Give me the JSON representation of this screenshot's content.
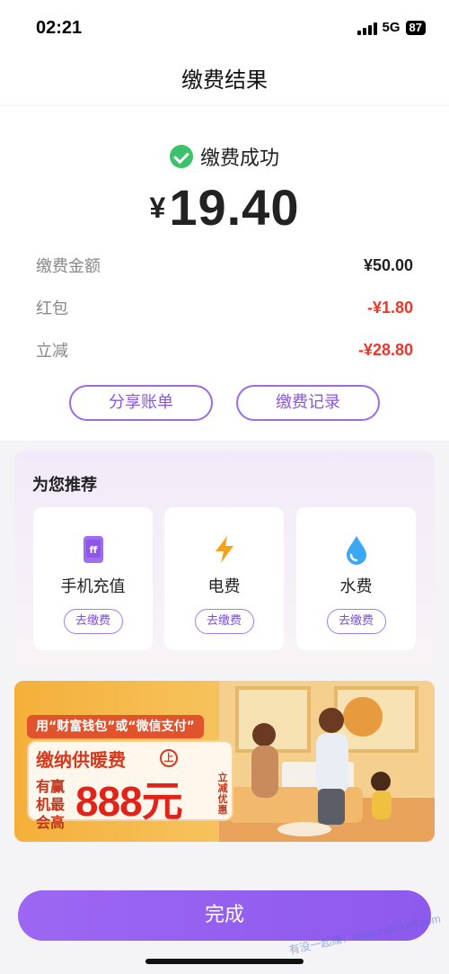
{
  "status_bar": {
    "time": "02:21",
    "network": "5G",
    "battery": "87"
  },
  "nav": {
    "title": "缴费结果"
  },
  "result": {
    "status_text": "缴费成功",
    "currency": "¥",
    "amount": "19.40",
    "details": [
      {
        "label": "缴费金额",
        "value": "¥50.00"
      },
      {
        "label": "红包",
        "value": "-¥1.80"
      },
      {
        "label": "立减",
        "value": "-¥28.80"
      }
    ],
    "share_button": "分享账单",
    "records_button": "缴费记录"
  },
  "recommend": {
    "title": "为您推荐",
    "items": [
      {
        "name": "手机充值",
        "icon": "phone-recharge-icon",
        "icon_glyph": "ff",
        "action": "去缴费"
      },
      {
        "name": "电费",
        "icon": "lightning-icon",
        "action": "去缴费"
      },
      {
        "name": "水费",
        "icon": "water-drop-icon",
        "action": "去缴费"
      }
    ]
  },
  "banner": {
    "tag": "用“财富钱包”或“微信支付”",
    "headline": "缴纳供暖费",
    "badge": "上",
    "small_text": "有赢机最会高",
    "big_text": "888元",
    "side_text": "立减优惠"
  },
  "done_button": "完成",
  "watermark": "有没一起赚！www.zuanke8.com",
  "colors": {
    "accent": "#8e59ee",
    "success": "#3cc26b",
    "negative": "#f0352b"
  }
}
